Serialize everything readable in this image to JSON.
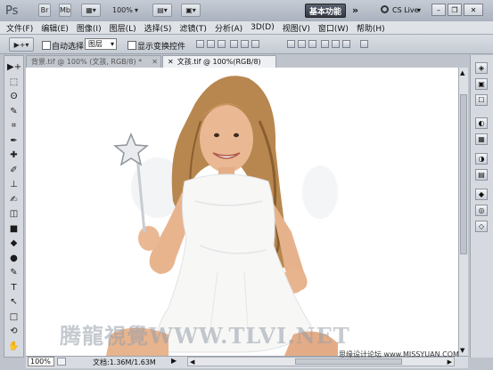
{
  "app": {
    "logo": "Ps",
    "bridge_label": "Br",
    "minibridge_label": "Mb",
    "zoom": "100%",
    "workspace": "基本功能",
    "expand": "»",
    "cs_live": "CS Live"
  },
  "menu": [
    "文件(F)",
    "编辑(E)",
    "图像(I)",
    "图层(L)",
    "选择(S)",
    "滤镜(T)",
    "分析(A)",
    "3D(D)",
    "视图(V)",
    "窗口(W)",
    "帮助(H)"
  ],
  "options": {
    "auto_select_label": "自动选择:",
    "auto_select_value": "图层",
    "show_transform_label": "显示变换控件"
  },
  "tabs": [
    {
      "title": "背景.tif @ 100% (文孩, RGB/8) *",
      "active": false
    },
    {
      "title": "文孩.tif @ 100%(RGB/8)",
      "active": true
    }
  ],
  "tools": [
    "move-tool",
    "marquee-tool",
    "lasso-tool",
    "quick-select-tool",
    "crop-tool",
    "eyedropper-tool",
    "healing-brush-tool",
    "brush-tool",
    "clone-stamp-tool",
    "history-brush-tool",
    "eraser-tool",
    "gradient-tool",
    "blur-tool",
    "dodge-tool",
    "pen-tool",
    "type-tool",
    "path-select-tool",
    "shape-tool",
    "3d-rotate-tool",
    "hand-tool"
  ],
  "tool_glyphs": [
    "▶+",
    "⬚",
    "ʘ",
    "✎",
    "⌗",
    "✒",
    "✚",
    "✐",
    "⊥",
    "✍",
    "◫",
    "■",
    "◆",
    "●",
    "✎",
    "T",
    "↖",
    "□",
    "⟲",
    "✋"
  ],
  "status": {
    "zoom": "100%",
    "doc_info": "文档:1.36M/1.63M"
  },
  "watermark": "腾龍視覺WWW.TLVI.NET",
  "credit": "思缘设计论坛 www.MISSYUAN.COM",
  "colors": {
    "accent": "#343a44",
    "panel": "#d6dae0",
    "dress": "#f7f7f5",
    "hair": "#b8874f",
    "skin": "#e8b48e"
  }
}
